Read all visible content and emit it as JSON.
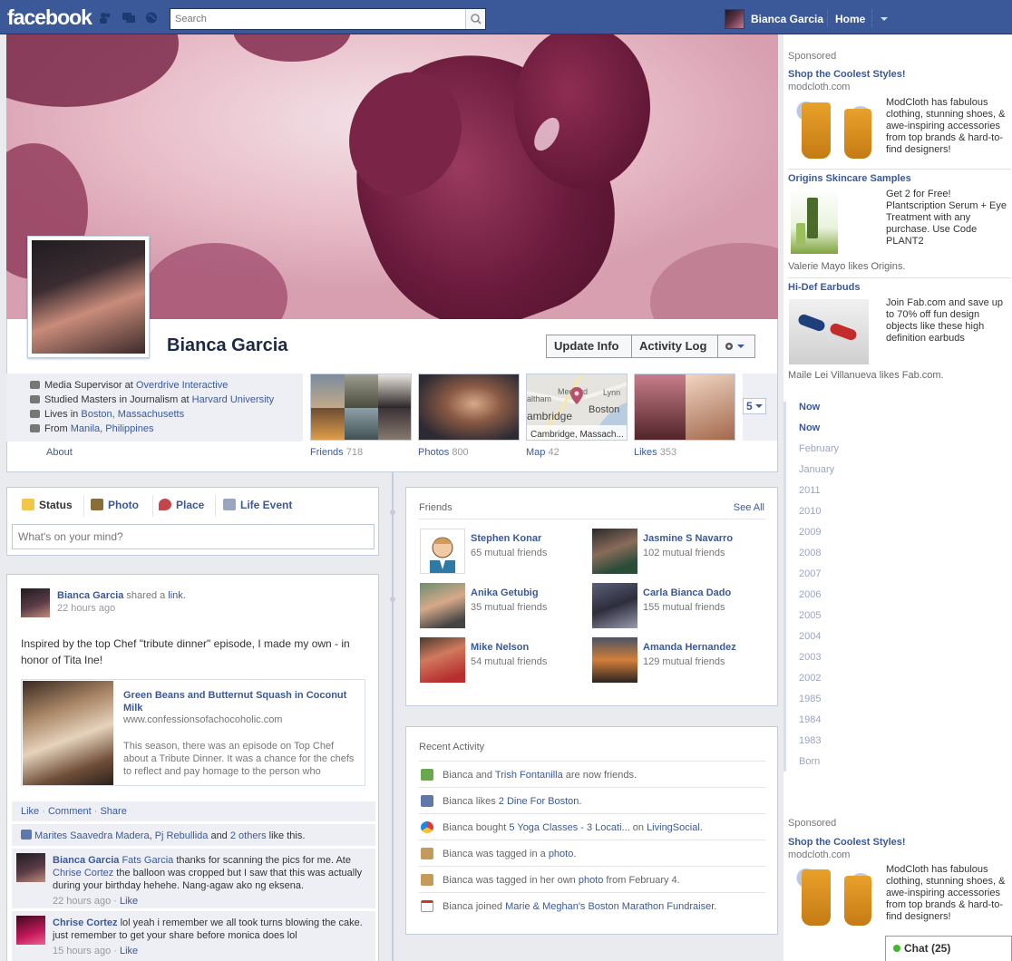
{
  "topbar": {
    "logo": "facebook",
    "search_placeholder": "Search",
    "user_name": "Bianca Garcia",
    "home": "Home"
  },
  "profile": {
    "name": "Bianca Garcia",
    "update_info": "Update Info",
    "activity_log": "Activity Log",
    "about": "About",
    "info": {
      "job_prefix": "Media Supervisor at ",
      "job_link": "Overdrive Interactive",
      "study_prefix": "Studied Masters in Journalism at ",
      "study_link": "Harvard University",
      "lives_prefix": "Lives in ",
      "lives_link": "Boston, Massachusetts",
      "from_prefix": "From ",
      "from_link": "Manila, Philippines"
    },
    "tiles": [
      {
        "label": "Friends",
        "count": "718"
      },
      {
        "label": "Photos",
        "count": "800"
      },
      {
        "label": "Map",
        "count": "42"
      },
      {
        "label": "Likes",
        "count": "353"
      }
    ],
    "more_count": "5",
    "map_labels": {
      "a": "altham",
      "b": "Medford",
      "c": "Lynn",
      "d": "ambridge",
      "e": "Boston",
      "f": "Cambridge, Massach..."
    }
  },
  "composer": {
    "tabs": [
      "Status",
      "Photo",
      "Place",
      "Life Event"
    ],
    "placeholder": "What's on your mind?"
  },
  "story": {
    "author": "Bianca Garcia",
    "action": " shared a ",
    "action_link": "link.",
    "time": "22 hours ago",
    "text": "Inspired by the top Chef \"tribute dinner\" episode, I made my own - in honor of Tita Ine!",
    "share_title": "Green Beans and Butternut Squash in Coconut Milk",
    "share_domain": "www.confessionsofachocoholic.com",
    "share_desc": "This season, there was an episode on Top Chef about a Tribute Dinner. It was a chance for the chefs to reflect and pay homage to the person who",
    "like": "Like",
    "comment": "Comment",
    "share": "Share",
    "likers_a": "Marites Saavedra Madera",
    "likers_b": "Pj Rebullida",
    "likers_and": " and ",
    "likers_c": "2 others",
    "likers_tail": " like this.",
    "comments": [
      {
        "author": "Bianca Garcia",
        "tag": "Fats Garcia",
        "text_a": " thanks for scanning the pics for me. Ate ",
        "tag2": "Chrise Cortez",
        "text_b": " the balloon was cropped but I saw that this was actually during your birthday hehehe. Nang-agaw ako ng eksena.",
        "time": "22 hours ago",
        "like": "Like"
      },
      {
        "author": "Chrise Cortez",
        "text": " lol yeah i remember we all took turns blowing the cake. just remember to get your share before monica does lol",
        "time": "15 hours ago",
        "like": "Like"
      }
    ]
  },
  "friends_box": {
    "title": "Friends",
    "see_all": "See All",
    "friends": [
      {
        "name": "Stephen Konar",
        "mutual": "65 mutual friends"
      },
      {
        "name": "Jasmine S Navarro",
        "mutual": "102 mutual friends"
      },
      {
        "name": "Anika Getubig",
        "mutual": "35 mutual friends"
      },
      {
        "name": "Carla Bianca Dado",
        "mutual": "155 mutual friends"
      },
      {
        "name": "Mike Nelson",
        "mutual": "54 mutual friends"
      },
      {
        "name": "Amanda Hernandez",
        "mutual": "129 mutual friends"
      }
    ]
  },
  "activity_box": {
    "title": "Recent Activity",
    "items": [
      {
        "pre": "Bianca and ",
        "link": "Trish Fontanilla",
        "post": " are now friends.",
        "link2": "",
        "post2": ""
      },
      {
        "pre": "Bianca likes ",
        "link": "2 Dine For Boston.",
        "post": "",
        "link2": "",
        "post2": ""
      },
      {
        "pre": "Bianca bought ",
        "link": "5 Yoga Classes - 3 Locati...",
        "post": " on ",
        "link2": "LivingSocial.",
        "post2": ""
      },
      {
        "pre": "Bianca was tagged in a ",
        "link": "photo.",
        "post": "",
        "link2": "",
        "post2": ""
      },
      {
        "pre": "Bianca was tagged in her own ",
        "link": "photo",
        "post": " from February 4.",
        "link2": "",
        "post2": ""
      },
      {
        "pre": "Bianca joined ",
        "link": "Marie & Meghan's Boston Marathon Fundraiser.",
        "post": "",
        "link2": "",
        "post2": ""
      }
    ]
  },
  "rail": {
    "sponsored": "Sponsored",
    "ads": [
      {
        "title": "Shop the Coolest Styles!",
        "domain": "modcloth.com",
        "text": "ModCloth has fabulous clothing, stunning shoes, & awe-inspiring accessories from top brands & hard-to-find designers!",
        "social": ""
      },
      {
        "title": "Origins Skincare Samples",
        "domain": "",
        "text": "Get 2 for Free! Plantscription Serum + Eye Treatment with any purchase. Use Code PLANT2",
        "social": "Valerie Mayo likes Origins."
      },
      {
        "title": "Hi-Def Earbuds",
        "domain": "",
        "text": "Join Fab.com and save up to 70% off fun design objects like these high definition earbuds",
        "social": "Maile Lei Villanueva likes Fab.com."
      }
    ],
    "sponsored2": "Sponsored",
    "ad_bottom": {
      "title": "Shop the Coolest Styles!",
      "domain": "modcloth.com",
      "text": "ModCloth has fabulous clothing, stunning shoes, & awe-inspiring accessories from top brands & hard-to-find designers!"
    },
    "years": [
      "Now",
      "Now",
      "February",
      "January",
      "2011",
      "2010",
      "2009",
      "2008",
      "2007",
      "2006",
      "2005",
      "2004",
      "2003",
      "2002",
      "1985",
      "1984",
      "1983",
      "Born"
    ]
  },
  "chat": {
    "label": "Chat",
    "count": "(25)"
  },
  "colors": {
    "brand": "#3b5998",
    "link": "#3b5998",
    "online": "#42b72a"
  }
}
